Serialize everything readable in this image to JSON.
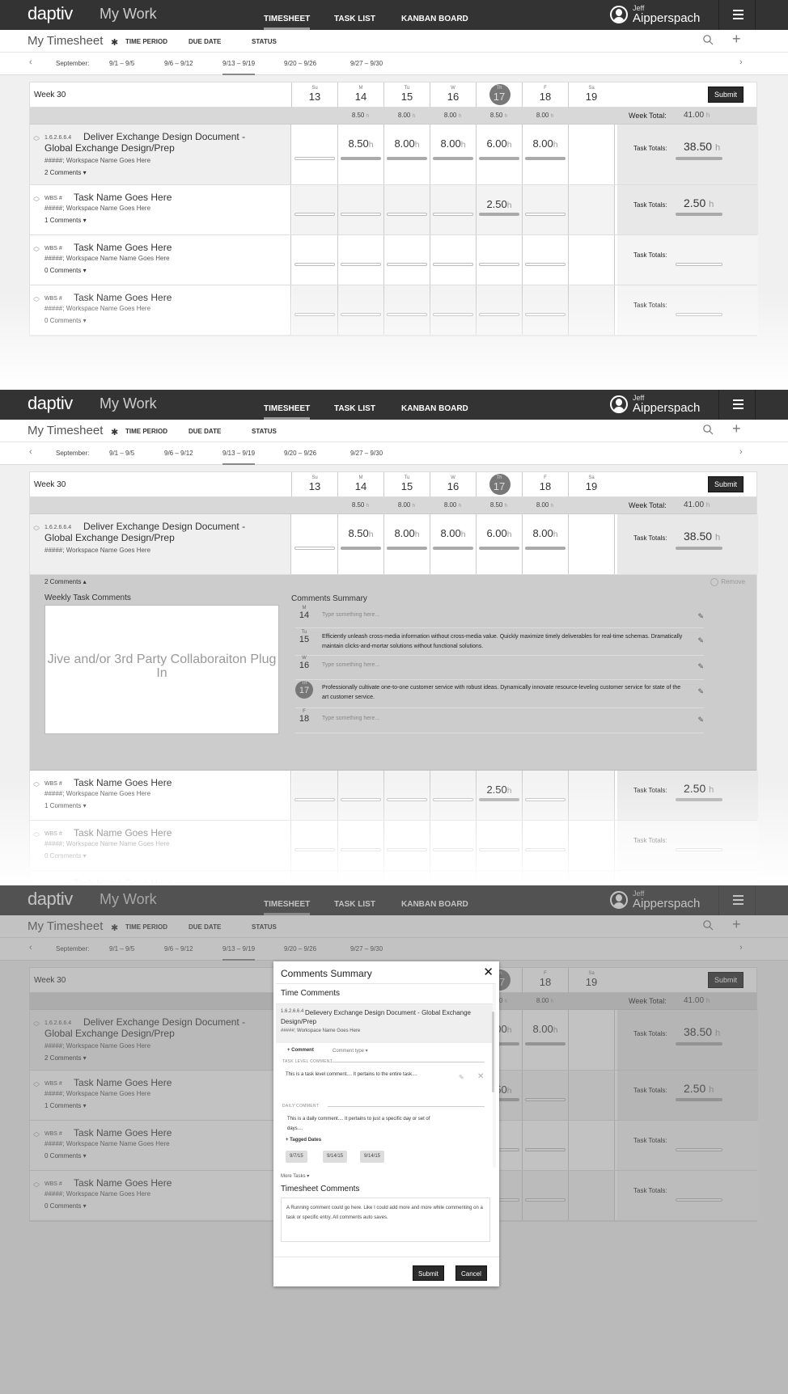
{
  "app": {
    "logo": "daptiv",
    "app_name": "My Work",
    "nav_tabs": [
      {
        "label": "TIMESHEET",
        "active": true
      },
      {
        "label": "TASK LIST",
        "active": false
      },
      {
        "label": "KANBAN BOARD",
        "active": false
      }
    ],
    "user": {
      "first_name": "Jeff",
      "last_name": "Aipperspach"
    },
    "menu_icon": "hamburger-icon"
  },
  "subbar": {
    "title": "My Timesheet",
    "settings_icon": "gear-icon",
    "filters": [
      "TIME PERIOD",
      "DUE DATE",
      "STATUS"
    ],
    "search_icon": "search-icon",
    "add_icon": "plus-icon"
  },
  "datebar": {
    "prev": "‹",
    "next": "›",
    "month": "September:",
    "ranges": [
      {
        "label": "9/1 – 9/5",
        "active": false
      },
      {
        "label": "9/6 – 9/12",
        "active": false
      },
      {
        "label": "9/13 – 9/19",
        "active": true
      },
      {
        "label": "9/20 – 9/26",
        "active": false
      },
      {
        "label": "9/27 – 9/30",
        "active": false
      }
    ]
  },
  "timesheet": {
    "week_label": "Week 30",
    "submit_label": "Submit",
    "days": [
      {
        "abbr": "Su",
        "num": "13",
        "total": "",
        "today": false
      },
      {
        "abbr": "M",
        "num": "14",
        "total": "8.50",
        "today": false
      },
      {
        "abbr": "Tu",
        "num": "15",
        "total": "8.00",
        "today": false
      },
      {
        "abbr": "W",
        "num": "16",
        "total": "8.00",
        "today": false
      },
      {
        "abbr": "Th",
        "num": "17",
        "total": "8.50",
        "today": true
      },
      {
        "abbr": "F",
        "num": "18",
        "total": "8.00",
        "today": false
      },
      {
        "abbr": "Sa",
        "num": "19",
        "total": "",
        "today": false
      }
    ],
    "hour_unit": "h",
    "week_total_label": "Week Total:",
    "week_total": "41.00",
    "task_totals_label": "Task Totals:",
    "tasks": [
      {
        "wbs": "1.6.2.6.6.4",
        "name": "Deliver Exchange Design Document - Global Exchange Design/Prep",
        "workspace": "#####; Workspace Name Goes Here",
        "comments": "2 Comments",
        "hours": [
          "",
          "8.50",
          "8.00",
          "8.00",
          "6.00",
          "8.00",
          ""
        ],
        "total": "38.50"
      },
      {
        "wbs": "WBS #",
        "name": "Task Name Goes Here",
        "workspace": "#####; Workspace Name Goes Here",
        "comments": "1 Comments",
        "hours": [
          "",
          "",
          "",
          "",
          "2.50",
          "",
          ""
        ],
        "total": "2.50"
      },
      {
        "wbs": "WBS #",
        "name": "Task Name Goes Here",
        "workspace": "#####; Workspace Name Name Goes Here",
        "comments": "0 Comments",
        "hours": [
          "",
          "",
          "",
          "",
          "",
          "",
          ""
        ],
        "total": ""
      },
      {
        "wbs": "WBS #",
        "name": "Task Name Goes Here",
        "workspace": "#####; Workspace Name Goes Here",
        "comments": "0 Comments",
        "hours": [
          "",
          "",
          "",
          "",
          "",
          "",
          ""
        ],
        "total": ""
      }
    ]
  },
  "expanded": {
    "comments_toggle": "2 Comments",
    "remove_label": "Remove",
    "weekly_heading": "Weekly Task Comments",
    "plugin_text": "Jive and/or 3rd Party Collaboraiton Plug In",
    "summary_heading": "Comments Summary",
    "placeholder": "Type something here...",
    "entries": [
      {
        "abbr": "M",
        "num": "14",
        "text": "",
        "today": false
      },
      {
        "abbr": "Tu",
        "num": "15",
        "text": "Efficiently unleash cross-media information without cross-media value. Quickly maximize timely deliverables for real-time schemas. Dramatically maintain clicks-and-mortar solutions without functional solutions.",
        "today": false
      },
      {
        "abbr": "W",
        "num": "16",
        "text": "",
        "today": false
      },
      {
        "abbr": "Th",
        "num": "17",
        "text": "Professionally cultivate one-to-one customer service with robust ideas. Dynamically innovate resource-leveling customer service for state of the art customer service.",
        "today": true
      },
      {
        "abbr": "F",
        "num": "18",
        "text": "",
        "today": false
      }
    ]
  },
  "modal": {
    "title": "Comments Summary",
    "close": "✕",
    "time_comments": "Time Comments",
    "task_wbs": "1.6.2.6.6.4",
    "task_name": "Delievery Exchange Design Document - Global Exchange Design/Prep",
    "task_workspace": "#####; Workspace Name Goes Here",
    "add_comment": "+ Comment",
    "comment_type": "Comment type ▾",
    "task_level_label": "TASK LEVEL COMMENT",
    "task_level_text": "This is a task level comment.... It pertains to the entire task....",
    "daily_label": "DAILY COMMENT",
    "daily_text": "This is a daily comment.... It pertains to just a specific day or set of days....",
    "tagged_dates_label": "+ Tagged Dates",
    "tagged_dates": [
      "9/7/15",
      "9/14/15",
      "9/14/15"
    ],
    "more_tasks": "More Tasks ▾",
    "timesheet_comments_heading": "Timesheet Comments",
    "timesheet_comment_text": "A Running comment could go here. Like I could add more and more while commenting on a task or specific entry. All comments auto saves.",
    "submit_label": "Submit",
    "cancel_label": "Cancel"
  }
}
